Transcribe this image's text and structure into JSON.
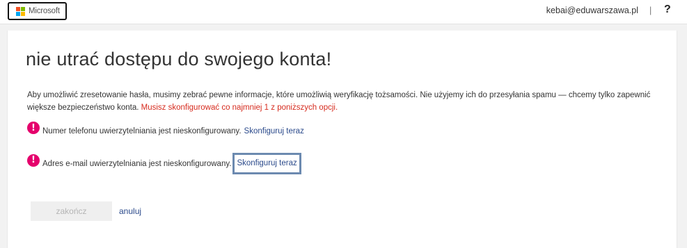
{
  "header": {
    "logo_text": "Microsoft",
    "user_email": "‌kebai@eduwarszawa.pl",
    "separator": "|",
    "help": "?"
  },
  "main": {
    "title": "nie utrać dostępu do swojego konta!",
    "intro_text": "Aby umożliwić zresetowanie hasła, musimy zebrać pewne informacje, które umożliwią weryfikację tożsamości. Nie użyjemy ich do przesyłania spamu — chcemy tylko zapewnić większe bezpieczeństwo konta. ",
    "intro_warning": "Musisz skonfigurować co najmniej 1 z poniższych opcji.",
    "items": [
      {
        "text": "Numer telefonu uwierzytelniania jest nieskonfigurowany.",
        "link": "Skonfiguruj teraz"
      },
      {
        "text": "Adres e-mail uwierzytelniania jest nieskonfigurowany.",
        "link": "Skonfiguruj teraz"
      }
    ],
    "alert_glyph": "!",
    "finish_label": "zakończ",
    "cancel_label": "anuluj"
  },
  "colors": {
    "accent_link": "#2b4a8b",
    "warning": "#d62b1e",
    "alert_icon": "#e5006c",
    "highlight_border": "#6c8ab0"
  }
}
